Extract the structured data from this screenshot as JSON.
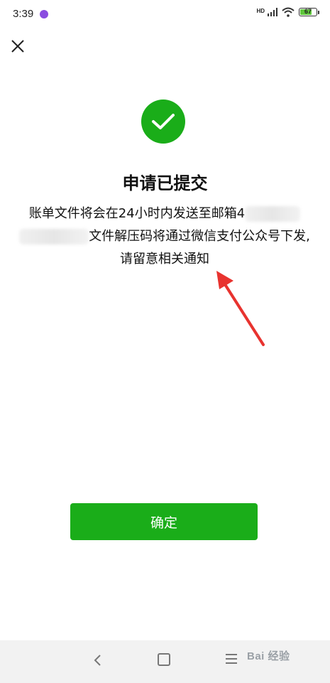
{
  "status_bar": {
    "time": "3:39",
    "hd_label": "HD",
    "battery_level": "67",
    "icons": [
      "app-notification-icon",
      "signal-icon",
      "wifi-icon",
      "battery-icon"
    ]
  },
  "header": {
    "close_icon": "close-icon"
  },
  "result": {
    "icon": "check-circle-icon",
    "title": "申请已提交",
    "message_part1": "账单文件将会在24小时内发送至邮箱4",
    "message_part2": "文件解压码将通过微信支付公众号下发,请留意相关通知"
  },
  "annotation": {
    "icon": "red-arrow-icon"
  },
  "actions": {
    "confirm_label": "确定"
  },
  "nav_bar": {
    "icons": [
      "back-icon",
      "home-icon",
      "menu-icon"
    ]
  },
  "watermark": {
    "text": "Bai 经验"
  },
  "colors": {
    "primary": "#1aad19",
    "arrow": "#e8332f"
  }
}
